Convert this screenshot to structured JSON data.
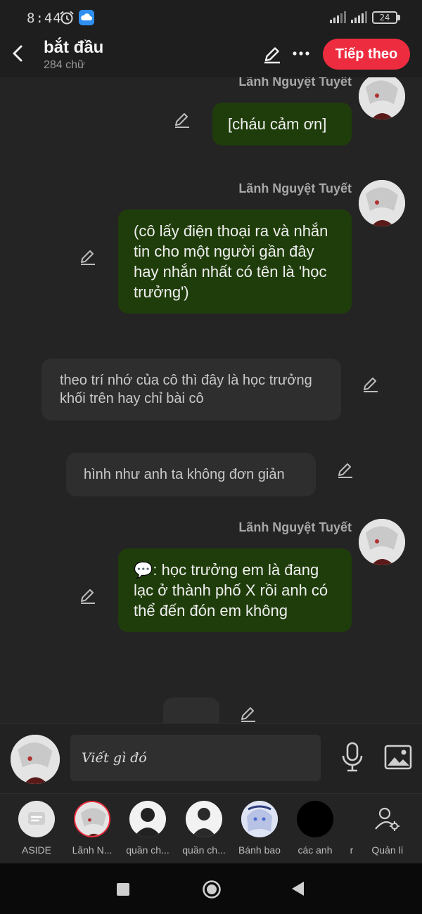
{
  "status_bar": {
    "time": "8:44",
    "battery": "24"
  },
  "header": {
    "title": "bắt đầu",
    "word_count": "284 chữ",
    "next_label": "Tiếp theo"
  },
  "chat": {
    "msg1": {
      "sender": "Lãnh Nguyệt Tuyết",
      "text": "[cháu cảm ơn]"
    },
    "msg2": {
      "sender": "Lãnh Nguyệt Tuyết",
      "text": "(cô lấy điện thoại ra và nhắn tin cho một người gần đây hay nhắn nhất có tên là 'học trưởng')"
    },
    "reply1": {
      "text": "theo trí nhớ của cô thì đây là học trưởng khối trên hay chỉ bài cô"
    },
    "reply2": {
      "text": "hình như anh ta không đơn giản"
    },
    "msg3": {
      "sender": "Lãnh Nguyệt Tuyết",
      "text": "💬: học trưởng em là đang lạc ở thành phố X rồi anh có thể đến đón em không"
    }
  },
  "composer": {
    "placeholder": "Viết gì đó"
  },
  "characters": [
    {
      "label": "ASIDE",
      "icon": "aside-icon"
    },
    {
      "label": "Lãnh N...",
      "icon": "anime-avatar"
    },
    {
      "label": "quần ch...",
      "icon": "silhouette-avatar"
    },
    {
      "label": "quần ch...",
      "icon": "silhouette-avatar"
    },
    {
      "label": "Bánh bao",
      "icon": "anime-avatar"
    },
    {
      "label": "các anh",
      "icon": "black-avatar"
    },
    {
      "label": "r",
      "icon": "hidden"
    },
    {
      "label": "Quản lí",
      "icon": "manage-icon"
    }
  ],
  "colors": {
    "accent": "#ee2c3f",
    "user_bubble": "#1f3d0a",
    "ai_bubble": "#2e2e2e",
    "background": "#242424"
  }
}
